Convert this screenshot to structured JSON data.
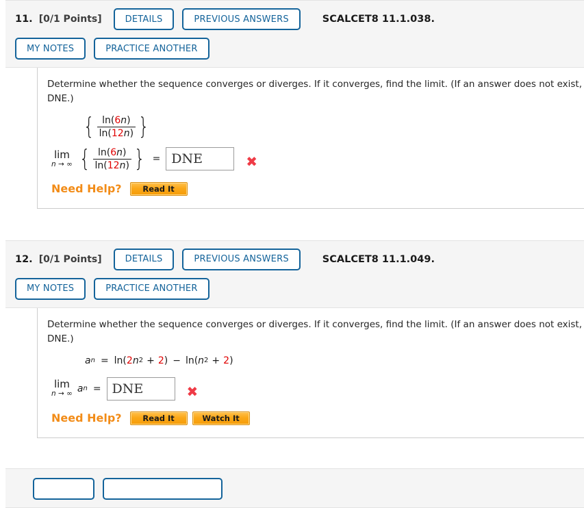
{
  "problems": [
    {
      "number": "11.",
      "points": "[0/1 Points]",
      "details_label": "DETAILS",
      "previous_answers_label": "PREVIOUS ANSWERS",
      "reference": "SCALCET8 11.1.038.",
      "my_notes_label": "MY NOTES",
      "practice_another_label": "PRACTICE ANOTHER",
      "prompt_line1": "Determine whether the sequence converges or diverges. If it converges, find the limit. (If an answer does not exist, enter",
      "prompt_line2": "DNE.)",
      "expression": {
        "type": "braced-fraction",
        "numerator_prefix": "ln(",
        "numerator_coefficient": "6",
        "numerator_variable": "n",
        "numerator_suffix": ")",
        "denominator_prefix": "ln(",
        "denominator_coefficient": "12",
        "denominator_variable": "n",
        "denominator_suffix": ")",
        "text": "{ ln(6n) / ln(12n) }"
      },
      "limit_label_top": "lim",
      "limit_label_bottom": "n → ∞",
      "equals": "=",
      "answer_value": "DNE",
      "answer_status_icon": "x-mark-icon",
      "answer_status": "incorrect",
      "need_help_label": "Need Help?",
      "help_buttons": [
        "Read It"
      ]
    },
    {
      "number": "12.",
      "points": "[0/1 Points]",
      "details_label": "DETAILS",
      "previous_answers_label": "PREVIOUS ANSWERS",
      "reference": "SCALCET8 11.1.049.",
      "my_notes_label": "MY NOTES",
      "practice_another_label": "PRACTICE ANOTHER",
      "prompt_line1": "Determine whether the sequence converges or diverges. If it converges, find the limit. (If an answer does not exist, enter",
      "prompt_line2": "DNE.)",
      "expression": {
        "type": "inline",
        "text": "aₙ = ln(2n² + 2) − ln(n² + 2)",
        "lhs_symbol": "a",
        "lhs_subscript": "n",
        "equals": "=",
        "term1_fn": "ln(",
        "term1_coefficient": "2",
        "term1_variable": "n",
        "term1_exponent": "2",
        "term1_plus": "+",
        "term1_constant": "2",
        "term1_close": ")",
        "minus": "−",
        "term2_fn": "ln(",
        "term2_variable": "n",
        "term2_exponent": "2",
        "term2_plus": "+",
        "term2_constant": "2",
        "term2_close": ")"
      },
      "limit_label_top": "lim",
      "limit_label_bottom": "n → ∞",
      "limit_of": "a",
      "limit_of_sub": "n",
      "equals": "=",
      "answer_value": "DNE",
      "answer_status_icon": "x-mark-icon",
      "answer_status": "incorrect",
      "need_help_label": "Need Help?",
      "help_buttons": [
        "Read It",
        "Watch It"
      ]
    },
    {
      "number": "",
      "points": "",
      "details_label": "",
      "previous_answers_label": "",
      "reference": "",
      "my_notes_label": "",
      "practice_another_label": "",
      "partial": true
    }
  ],
  "colors": {
    "pill_border": "#13639a",
    "pill_text": "#13639a",
    "help_accent": "#f28c18",
    "math_highlight": "#e00000",
    "incorrect": "#ef3b46",
    "header_bg": "#f5f5f5"
  }
}
